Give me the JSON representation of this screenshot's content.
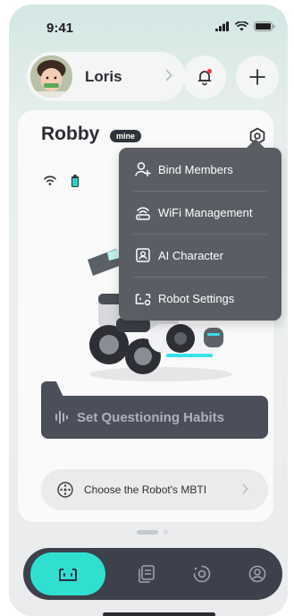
{
  "status_bar": {
    "time": "9:41"
  },
  "profile": {
    "name": "Loris"
  },
  "robot": {
    "name": "Robby",
    "badge": "mine"
  },
  "menu": {
    "items": [
      {
        "label": "Bind Members",
        "icon": "add-user-icon"
      },
      {
        "label": "WiFi Management",
        "icon": "wifi-router-icon"
      },
      {
        "label": "AI Character",
        "icon": "character-card-icon"
      },
      {
        "label": "Robot Settings",
        "icon": "robot-settings-icon"
      }
    ]
  },
  "habits_button": {
    "label": "Set Questioning Habits"
  },
  "mbti": {
    "label": "Choose the Robot's MBTI"
  },
  "tabs": [
    "robot-icon",
    "document-icon",
    "discover-icon",
    "profile-icon"
  ],
  "colors": {
    "accent": "#2fe0d1",
    "menu_bg": "#5b5d65",
    "tab_bar": "#3d414b"
  }
}
